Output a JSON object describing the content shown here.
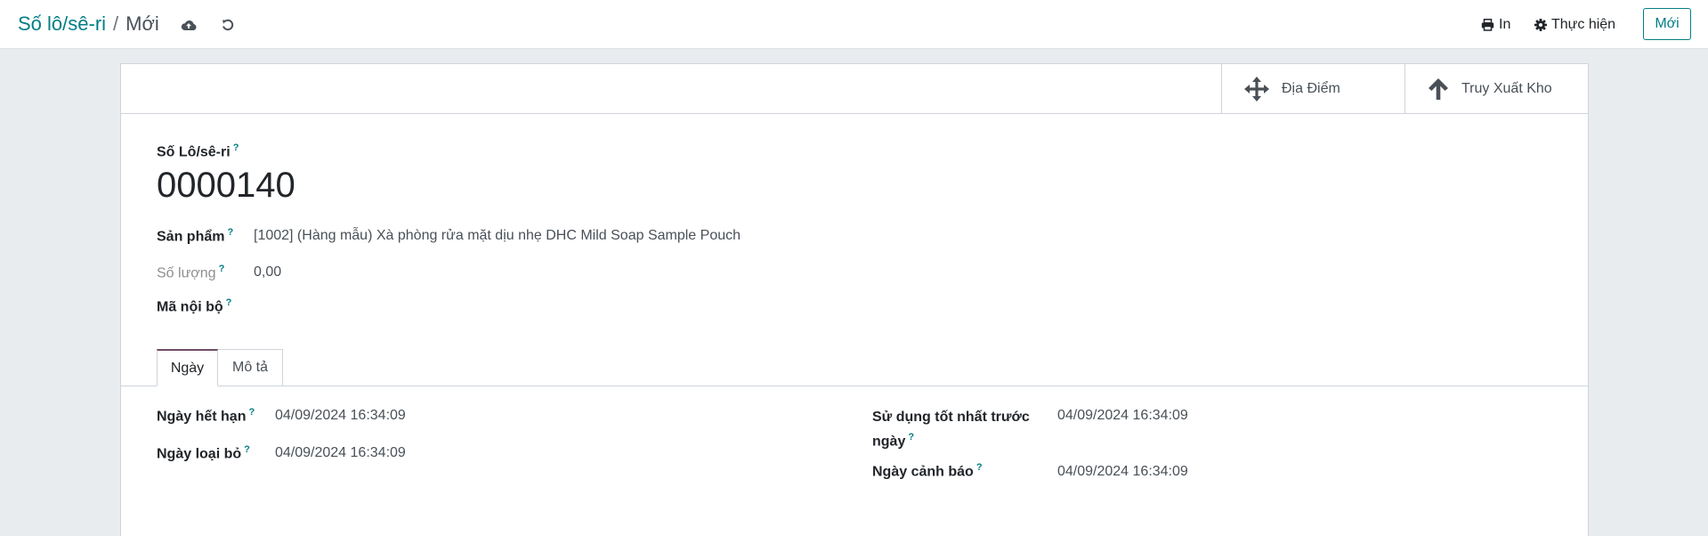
{
  "breadcrumb": {
    "parent": "Số lô/sê-ri",
    "separator": "/",
    "current": "Mới"
  },
  "toolbar": {
    "save_icon": "cloud-upload-icon",
    "discard_icon": "undo-icon",
    "print_label": "In",
    "actions_label": "Thực hiện",
    "new_label": "Mới"
  },
  "stat_buttons": {
    "locations_label": "Địa Điểm",
    "traceability_label": "Truy Xuất Kho"
  },
  "form": {
    "lot_label": "Số Lô/sê-ri",
    "lot_name": "0000140",
    "product_label": "Sản phẩm",
    "product_value": "[1002] (Hàng mẫu) Xà phòng rửa mặt dịu nhẹ DHC Mild Soap Sample Pouch",
    "quantity_label": "Số lượng",
    "quantity_value": "0,00",
    "internal_ref_label": "Mã nội bộ",
    "help_mark": "?"
  },
  "tabs": [
    {
      "label": "Ngày",
      "active": true
    },
    {
      "label": "Mô tả",
      "active": false
    }
  ],
  "dates": {
    "expiration_label": "Ngày hết hạn",
    "expiration_value": "04/09/2024 16:34:09",
    "removal_label": "Ngày loại bỏ",
    "removal_value": "04/09/2024 16:34:09",
    "best_before_label_line1": "Sử dụng tốt nhất trước",
    "best_before_label_line2": "ngày",
    "best_before_value": "04/09/2024 16:34:09",
    "alert_label": "Ngày cảnh báo",
    "alert_value": "04/09/2024 16:34:09"
  },
  "colors": {
    "brand": "#017e84",
    "tab_accent": "#714b67",
    "background": "#e9ecef"
  }
}
